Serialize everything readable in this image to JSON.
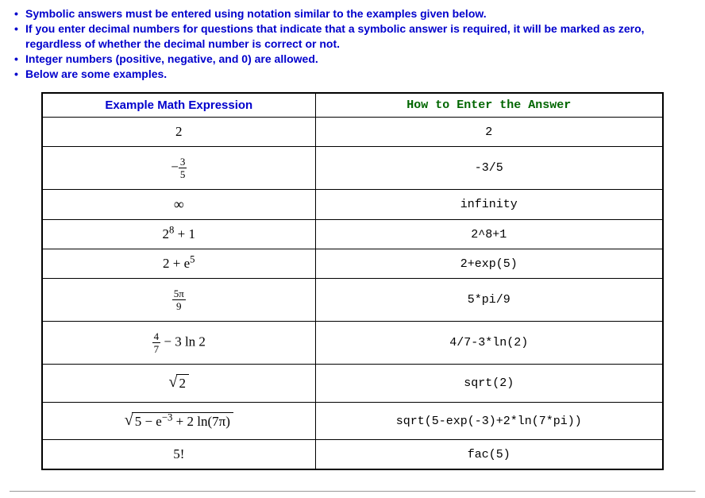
{
  "instructions": [
    "Symbolic answers must be entered using notation similar to the examples given below.",
    "If you enter decimal numbers for questions that indicate that a symbolic answer is required, it will be marked as zero, regardless of whether the decimal number is correct or not.",
    "Integer numbers (positive, negative, and 0) are allowed.",
    "Below are some examples."
  ],
  "table": {
    "header_expr": "Example Math Expression",
    "header_entry": "How to Enter the Answer",
    "rows": [
      {
        "expr_text": "2",
        "entry": "2"
      },
      {
        "expr_parts": {
          "prefix": "−",
          "frac_num": "3",
          "frac_den": "5"
        },
        "entry": "-3/5"
      },
      {
        "expr_text": "∞",
        "entry": "infinity"
      },
      {
        "expr_parts": {
          "base": "2",
          "sup": "8",
          "suffix": " + 1"
        },
        "entry": "2^8+1"
      },
      {
        "expr_parts": {
          "prefix": "2 + ",
          "base": "e",
          "sup": "5"
        },
        "entry": "2+exp(5)"
      },
      {
        "expr_parts": {
          "frac_num": "5π",
          "frac_den": "9"
        },
        "entry": "5*pi/9"
      },
      {
        "expr_parts": {
          "frac_num": "4",
          "frac_den": "7",
          "suffix": " − 3 ln 2"
        },
        "entry": "4/7-3*ln(2)"
      },
      {
        "expr_parts": {
          "radicand": "2"
        },
        "entry": "sqrt(2)"
      },
      {
        "expr_parts": {
          "radicand_complex": {
            "a": "5 − ",
            "base": "e",
            "sup": "−3",
            "b": " + 2 ln(7π)"
          }
        },
        "entry": "sqrt(5-exp(-3)+2*ln(7*pi))"
      },
      {
        "expr_text": "5!",
        "entry": "fac(5)"
      }
    ]
  }
}
